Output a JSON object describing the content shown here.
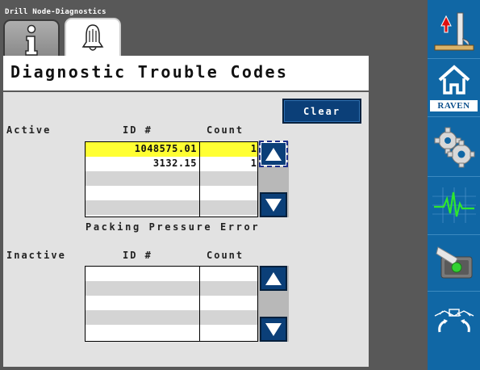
{
  "window": {
    "title": "Drill Node-Diagnostics"
  },
  "tabs": [
    {
      "name": "info",
      "icon": "info-icon",
      "active": false
    },
    {
      "name": "diagnostics",
      "icon": "alarm-bell-icon",
      "active": true
    }
  ],
  "page": {
    "title": "Diagnostic Trouble Codes"
  },
  "clear_button": {
    "label": "Clear"
  },
  "active": {
    "label": "Active",
    "col_id": "ID #",
    "col_count": "Count",
    "rows": [
      {
        "id": "1048575.01",
        "count": "1",
        "selected": true
      },
      {
        "id": "3132.15",
        "count": "1",
        "selected": false
      },
      {
        "id": "",
        "count": ""
      },
      {
        "id": "",
        "count": ""
      },
      {
        "id": "",
        "count": ""
      }
    ],
    "description": "Packing Pressure Error"
  },
  "inactive": {
    "label": "Inactive",
    "col_id": "ID #",
    "col_count": "Count",
    "rows": [
      {
        "id": "",
        "count": ""
      },
      {
        "id": "",
        "count": ""
      },
      {
        "id": "",
        "count": ""
      },
      {
        "id": "",
        "count": ""
      },
      {
        "id": "",
        "count": ""
      }
    ]
  },
  "sidebar": {
    "items": [
      {
        "icon": "implement-lift-icon"
      },
      {
        "icon": "home-icon",
        "label": "RAVEN"
      },
      {
        "icon": "gears-icon"
      },
      {
        "icon": "waveform-icon"
      },
      {
        "icon": "toggle-switch-icon"
      },
      {
        "icon": "boom-fold-icon"
      }
    ]
  },
  "colors": {
    "sidebar": "#1067a5",
    "button": "#0b3f78",
    "selected_row": "#ffff33",
    "panel": "#e2e2e2",
    "frame": "#585858"
  }
}
